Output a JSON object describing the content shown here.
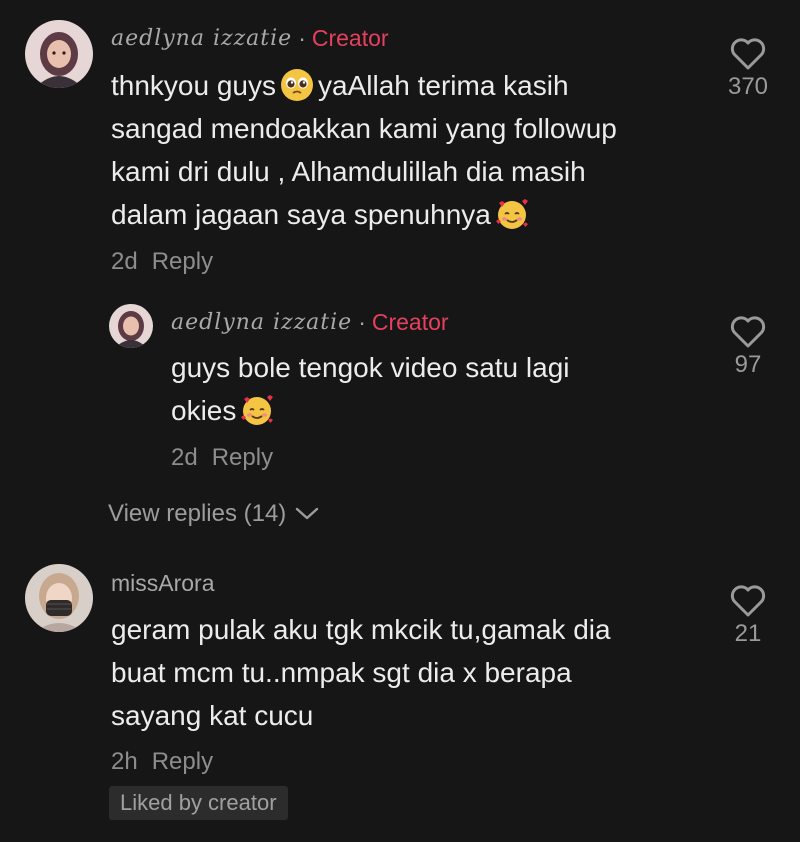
{
  "comments": [
    {
      "username": "aedlyna izzatie",
      "separator": "·",
      "badge": "Creator",
      "lines": [
        "thnkyou guys",
        "yaAllah terima kasih",
        "sangad mendoakkan kami yang followup",
        "kami dri dulu , Alhamdulillah dia masih",
        "dalam jagaan saya spenuhnya"
      ],
      "time": "2d",
      "reply_label": "Reply",
      "likes": "370"
    },
    {
      "username": "aedlyna izzatie",
      "separator": "·",
      "badge": "Creator",
      "lines": [
        "guys bole tengok video satu lagi",
        "okies"
      ],
      "time": "2d",
      "reply_label": "Reply",
      "likes": "97"
    },
    {
      "username": "missArora",
      "lines": [
        "geram pulak aku tgk mkcik tu,gamak dia",
        "buat mcm tu..nmpak sgt dia x berapa",
        "sayang kat cucu"
      ],
      "time": "2h",
      "reply_label": "Reply",
      "likes": "21",
      "liked_badge": "Liked by creator"
    }
  ],
  "view_replies": "View replies (14)",
  "icons": {
    "like": "heart-outline-icon",
    "pleading": "pleading-face-emoji",
    "hearts": "smiling-face-with-hearts-emoji",
    "chevron": "chevron-down-icon"
  },
  "colors": {
    "background": "#161616",
    "creator": "#e5405e",
    "text": "#ececec",
    "muted": "#8d8d8d"
  }
}
